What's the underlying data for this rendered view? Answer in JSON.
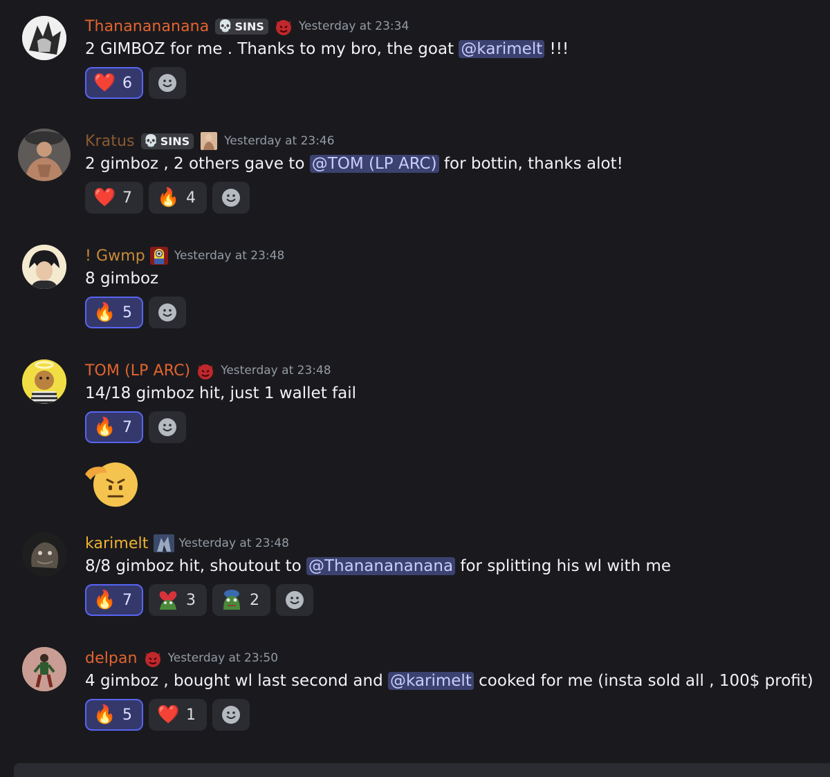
{
  "messages": [
    {
      "username": "Thananananana",
      "username_color": "#e3642f",
      "tag": "SINS",
      "role_icon": "devil-icon",
      "timestamp": "Yesterday at 23:34",
      "text_before": "2 GIMBOZ for me . Thanks to my bro, the goat",
      "mention": "@karimelt",
      "text_after": "!!!",
      "reactions": [
        {
          "emoji": "heart",
          "glyph": "❤️",
          "count": "6",
          "active": true
        }
      ]
    },
    {
      "username": "Kratus",
      "username_color": "#8b5a32",
      "tag": "SINS",
      "role_icon": "character-icon",
      "timestamp": "Yesterday at 23:46",
      "text_before": "2 gimboz , 2 others gave to",
      "mention": "@TOM (LP ARC)",
      "text_after": "for bottin, thanks alot!",
      "reactions": [
        {
          "emoji": "heart",
          "glyph": "❤️",
          "count": "7",
          "active": false
        },
        {
          "emoji": "fire",
          "glyph": "🔥",
          "count": "4",
          "active": false
        }
      ]
    },
    {
      "username": "! Gwmp",
      "username_color": "#c88a3a",
      "role_icon": "minion-icon",
      "timestamp": "Yesterday at 23:48",
      "text_before": "8 gimboz",
      "reactions": [
        {
          "emoji": "fire",
          "glyph": "🔥",
          "count": "5",
          "active": true
        }
      ]
    },
    {
      "username": "TOM (LP ARC)",
      "username_color": "#e3642f",
      "role_icon": "devil-icon",
      "timestamp": "Yesterday at 23:48",
      "text_before": "14/18 gimboz hit, just 1 wallet fail",
      "reactions": [
        {
          "emoji": "fire",
          "glyph": "🔥",
          "count": "7",
          "active": true
        }
      ],
      "big_emoji": "saluting-face"
    },
    {
      "username": "karimelt",
      "username_color": "#f0b232",
      "role_icon": "knight-icon",
      "timestamp": "Yesterday at 23:48",
      "text_before": "8/8 gimboz hit, shoutout to",
      "mention": "@Thananananana",
      "text_after": "for splitting his wl with me",
      "reactions": [
        {
          "emoji": "fire",
          "glyph": "🔥",
          "count": "7",
          "active": true
        },
        {
          "emoji": "pepe-heart",
          "glyph": "",
          "count": "3",
          "active": false
        },
        {
          "emoji": "pepe-hat",
          "glyph": "",
          "count": "2",
          "active": false
        }
      ]
    },
    {
      "username": "delpan",
      "username_color": "#e3642f",
      "role_icon": "devil-icon",
      "timestamp": "Yesterday at 23:50",
      "text_before": "4 gimboz , bought wl last second and",
      "mention": "@karimelt",
      "text_after": "cooked for me (insta sold all , 100$ profit)",
      "reactions": [
        {
          "emoji": "fire",
          "glyph": "🔥",
          "count": "5",
          "active": true
        },
        {
          "emoji": "heart",
          "glyph": "❤️",
          "count": "1",
          "active": false
        }
      ]
    }
  ]
}
